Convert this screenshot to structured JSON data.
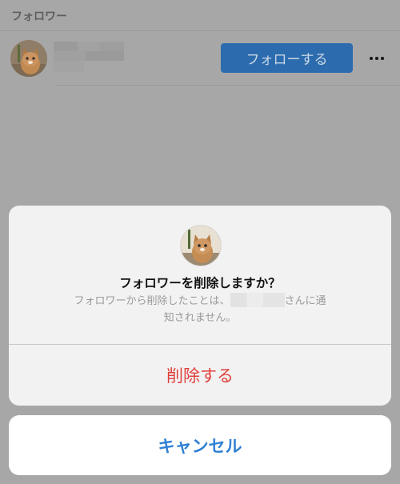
{
  "background": {
    "section_title": "フォロワー",
    "row": {
      "follow_label": "フォローする",
      "more_icon": "more-horizontal-icon"
    }
  },
  "sheet": {
    "avatar": "cat-avatar-image",
    "title": "フォロワーを削除しますか？",
    "message_line1_before": "フォロワーから削除したことは、",
    "message_line1_after": "さんに通",
    "message_line2": "知されません。",
    "delete_label": "削除する"
  },
  "cancel_label": "キャンセル",
  "colors": {
    "destructive": "#e0403b",
    "accent": "#2f80d3",
    "follow_button": "#2c6cae"
  }
}
